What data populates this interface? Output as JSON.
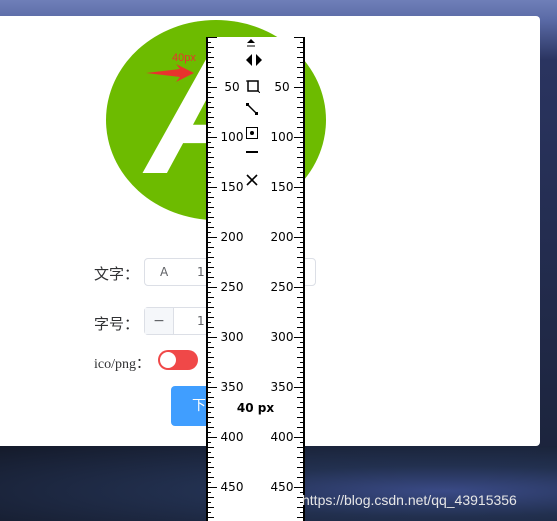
{
  "logo": {
    "letter": "A",
    "color": "#6dbb00"
  },
  "annotation": {
    "measure_label": "40px",
    "color": "#e8332d"
  },
  "form": {
    "text_label": "文字：",
    "text_value": "A",
    "text_value_2": "1",
    "size_label": "字号：",
    "size_minus": "−",
    "size_value": "1",
    "format_label": "ico/png：",
    "toggle_on": true,
    "toggle_color": "#f04848",
    "download_label": "下"
  },
  "ruler": {
    "icons": [
      "collapse-icon",
      "flip-horizontal-icon",
      "crop-icon",
      "diagonal-resize-icon",
      "center-target-icon",
      "minus-icon",
      "close-icon"
    ],
    "tick_labels": [
      "50",
      "100",
      "150",
      "200",
      "250",
      "300",
      "350",
      "400",
      "450"
    ],
    "readout": "40 px"
  },
  "watermark": "https://blog.csdn.net/qq_43915356"
}
